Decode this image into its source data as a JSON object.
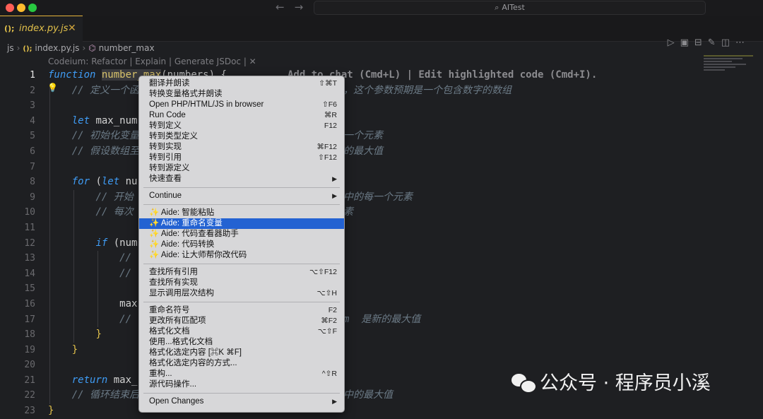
{
  "window": {
    "title": "AITest"
  },
  "editor_tab": {
    "icon": "();",
    "filename": "index.py.js",
    "close": "✕"
  },
  "breadcrumb": {
    "folder": "js",
    "file_icon": "();",
    "file": "index.py.js",
    "symbol_icon": "symbol-function-icon",
    "symbol": "number_max"
  },
  "codeium_lens": "Codeium: Refactor | Explain | Generate JSDoc | ✕",
  "line_numbers": [
    "1",
    "2",
    "3",
    "4",
    "5",
    "6",
    "7",
    "8",
    "9",
    "10",
    "11",
    "12",
    "13",
    "14",
    "15",
    "16",
    "17",
    "18",
    "19",
    "20",
    "21",
    "22",
    "23"
  ],
  "code": {
    "l1_kw": "function",
    "l1_fn": "number_max",
    "l1_paren": "(numbers) {",
    "l1_hint": "Add to chat (Cmd+L) | Edit highlighted code (Cmd+I).",
    "l2a": "// 定义一个函",
    "l2b": "，这个参数预期是一个包含数字的数组",
    "l4_kw": "let",
    "l4": " max_num",
    "l5a": "// 初始化变量",
    "l5b": "一个元素",
    "l6a": "// 假设数组至",
    "l6b": "的最大值",
    "l8_kw": "for",
    "l8_kw2": "let",
    "l8": " nu",
    "l9a": "// 开始",
    "l9b": "中的每一个元素",
    "l10a": "// 每次",
    "l10b": "素",
    "l12_kw": "if",
    "l12": " (num",
    "l13": "//",
    "l14": "//",
    "l16": "max",
    "l17a": "//",
    "l17b": "m  是新的最大值",
    "l18": "}",
    "l19": "}",
    "l21_kw": "return",
    "l21": " max_",
    "l22a": "// 循环结束后",
    "l22b": "中的最大值",
    "l23": "}"
  },
  "context_menu": {
    "items": [
      {
        "label": "翻译并朗读",
        "shortcut": "⇧⌘T"
      },
      {
        "label": "转换变量格式并朗读",
        "shortcut": ""
      },
      {
        "label": "Open PHP/HTML/JS in browser",
        "shortcut": "⇧F6"
      },
      {
        "label": "Run Code",
        "shortcut": "⌘R"
      },
      {
        "label": "转到定义",
        "shortcut": "F12"
      },
      {
        "label": "转到类型定义",
        "shortcut": ""
      },
      {
        "label": "转到实现",
        "shortcut": "⌘F12"
      },
      {
        "label": "转到引用",
        "shortcut": "⇧F12"
      },
      {
        "label": "转到源定义",
        "shortcut": ""
      },
      {
        "label": "快速查看",
        "shortcut": "▶"
      },
      {
        "label": "Continue",
        "shortcut": "▶"
      },
      {
        "label": "Aide: 智能粘贴",
        "shortcut": ""
      },
      {
        "label": "Aide: 重命名变量",
        "shortcut": ""
      },
      {
        "label": "Aide: 代码查看器助手",
        "shortcut": ""
      },
      {
        "label": "Aide: 代码转换",
        "shortcut": ""
      },
      {
        "label": "Aide: 让大师帮你改代码",
        "shortcut": ""
      },
      {
        "label": "查找所有引用",
        "shortcut": "⌥⇧F12"
      },
      {
        "label": "查找所有实现",
        "shortcut": ""
      },
      {
        "label": "显示调用层次结构",
        "shortcut": "⌥⇧H"
      },
      {
        "label": "重命名符号",
        "shortcut": "F2"
      },
      {
        "label": "更改所有匹配项",
        "shortcut": "⌘F2"
      },
      {
        "label": "格式化文档",
        "shortcut": "⌥⇧F"
      },
      {
        "label": "使用...格式化文档",
        "shortcut": ""
      },
      {
        "label": "格式化选定内容 [⌘K ⌘F]",
        "shortcut": ""
      },
      {
        "label": "格式化选定内容的方式...",
        "shortcut": ""
      },
      {
        "label": "重构...",
        "shortcut": "^⇧R"
      },
      {
        "label": "源代码操作...",
        "shortcut": ""
      },
      {
        "label": "Open Changes",
        "shortcut": "▶"
      }
    ],
    "aide_icon": "✨",
    "selected_index": 12
  },
  "watermark": {
    "text": "公众号 · 程序员小溪"
  },
  "colors": {
    "accent_yellow": "#e2c14b",
    "selection_blue": "#2362d2",
    "keyword_blue": "#3f9cf5",
    "comment": "#6b7a86"
  }
}
